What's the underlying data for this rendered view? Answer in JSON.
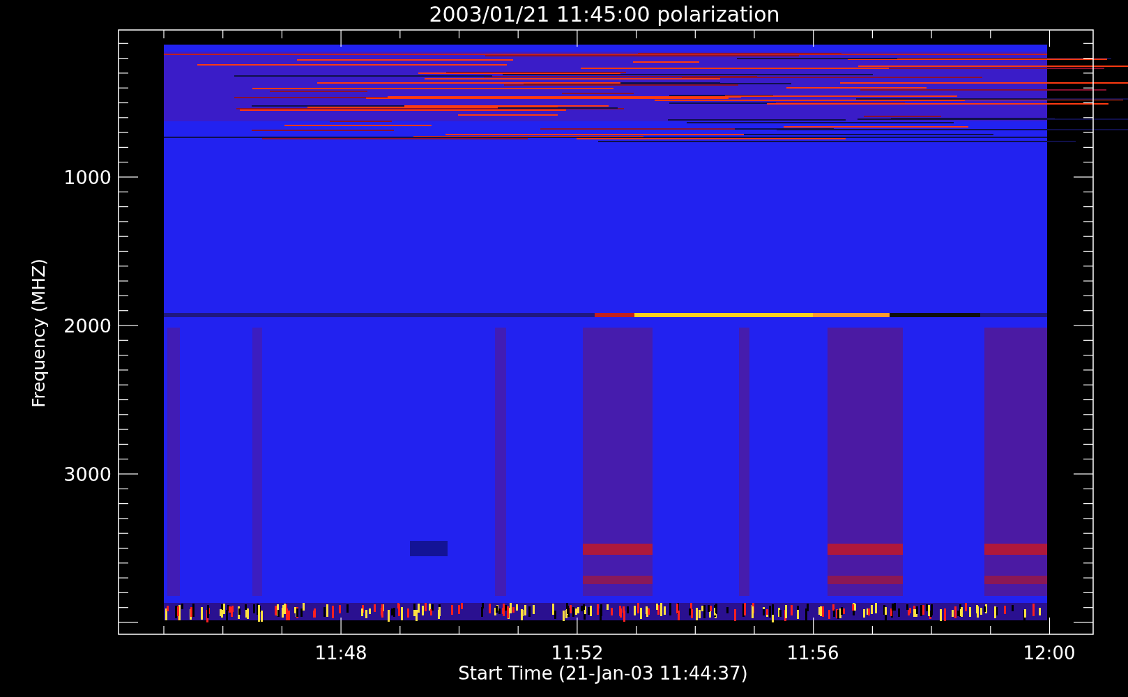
{
  "title": "2003/01/21 11:45:00 polarization",
  "y_axis": {
    "label": "Frequency (MHZ)",
    "tick_labels": [
      "1000",
      "2000",
      "3000"
    ]
  },
  "x_axis": {
    "label": "Start Time (21-Jan-03 11:44:37)",
    "tick_labels": [
      "11:48",
      "11:52",
      "11:56",
      "12:00"
    ]
  }
}
